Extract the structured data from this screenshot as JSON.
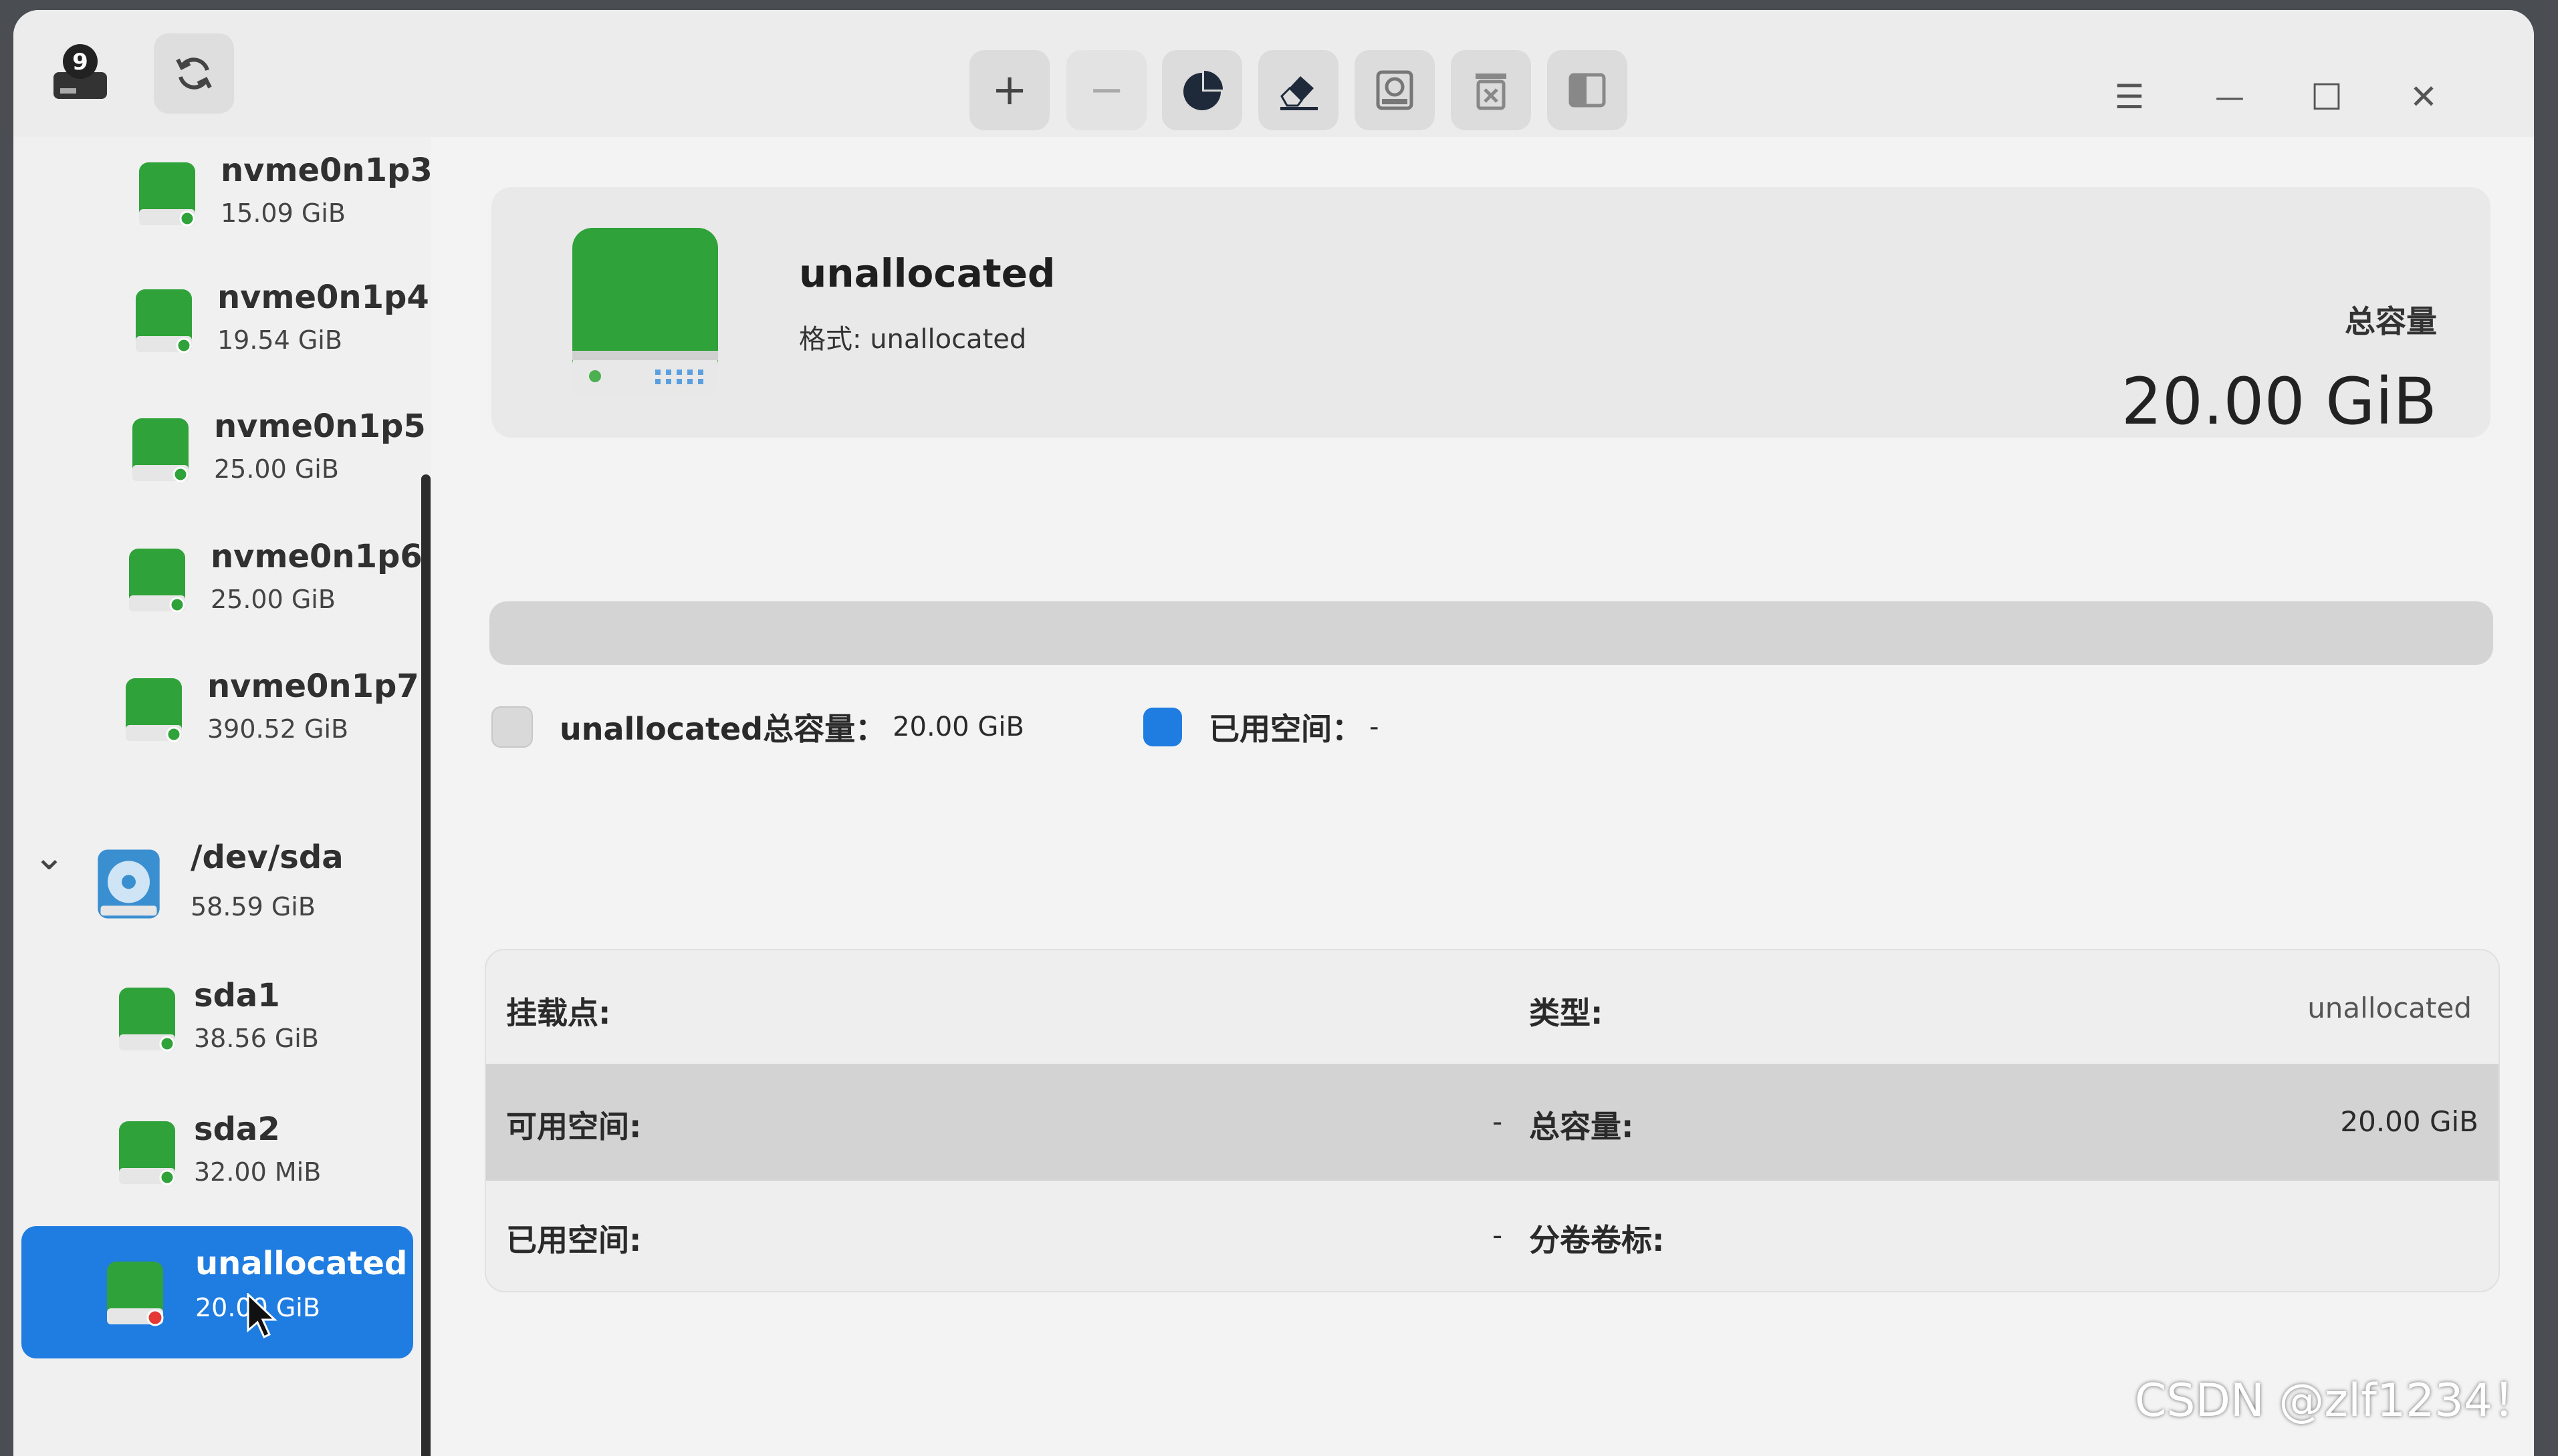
{
  "toolbar": {
    "create_label": "+",
    "delete_label": "−"
  },
  "window_controls": {
    "menu": "☰",
    "minimize": "—",
    "maximize": "☐",
    "close": "✕"
  },
  "sidebar": {
    "partitions": [
      {
        "name": "nvme0n1p3",
        "size": "15.09 GiB"
      },
      {
        "name": "nvme0n1p4",
        "size": "19.54 GiB"
      },
      {
        "name": "nvme0n1p5",
        "size": "25.00 GiB"
      },
      {
        "name": "nvme0n1p6",
        "size": "25.00 GiB"
      },
      {
        "name": "nvme0n1p7",
        "size": "390.52 GiB"
      }
    ],
    "device": {
      "expander": "⌄",
      "name": "/dev/sda",
      "size": "58.59 GiB"
    },
    "device_partitions": [
      {
        "name": "sda1",
        "size": "38.56 GiB"
      },
      {
        "name": "sda2",
        "size": "32.00 MiB"
      },
      {
        "name": "unallocated",
        "size": "20.00 GiB"
      }
    ]
  },
  "info": {
    "title": "unallocated",
    "format": "格式: unallocated",
    "capacity_label": "总容量",
    "capacity_value": "20.00 GiB"
  },
  "legend": {
    "total_label": "unallocated总容量：",
    "total_value": "20.00 GiB",
    "used_label": "已用空间：",
    "used_value": "-"
  },
  "details": {
    "mount_label": "挂载点:",
    "mount_value": "",
    "type_label": "类型:",
    "type_value": "unallocated",
    "free_label": "可用空间:",
    "free_value": "-",
    "total_label": "总容量:",
    "total_value": "20.00 GiB",
    "used_label": "已用空间:",
    "used_value": "-",
    "volume_label": "分卷卷标:",
    "volume_value": ""
  },
  "watermark": "CSDN @zlf1234！",
  "colors": {
    "accent": "#1f7ce0",
    "disk_green": "#2fa23a",
    "legend_total": "#d9d9d9",
    "legend_used": "#1f7ce0"
  }
}
